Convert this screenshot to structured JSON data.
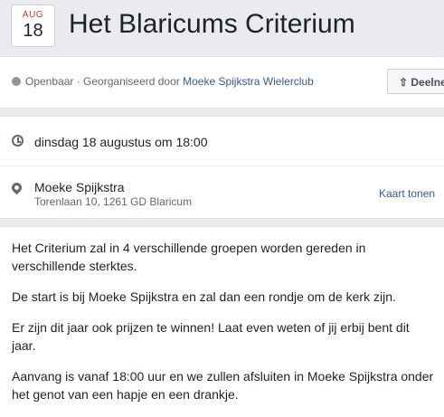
{
  "event": {
    "month": "AUG",
    "day": "18",
    "title": "Het Blaricums Criterium"
  },
  "meta": {
    "visibility": "Openbaar · Georganiseerd door ",
    "organizer": "Moeke Spijkstra Wielerclub",
    "share_label": "Deelnen"
  },
  "details": {
    "datetime": "dinsdag 18 augustus om 18:00",
    "venue_name": "Moeke Spijkstra",
    "venue_address": "Torenlaan 10, 1261 GD Blaricum",
    "map_link": "Kaart tonen"
  },
  "description": [
    "Het Criterium zal in 4 verschillende groepen worden gereden in verschillende sterktes.",
    "De start is bij Moeke Spijkstra en zal dan een rondje om de kerk zijn.",
    "Er zijn dit jaar ook prijzen te winnen! Laat even weten of jij erbij bent dit jaar.",
    "Aanvang is vanaf 18:00 uur en we zullen afsluiten in Moeke Spijkstra onder het genot van een hapje en een drankje."
  ]
}
